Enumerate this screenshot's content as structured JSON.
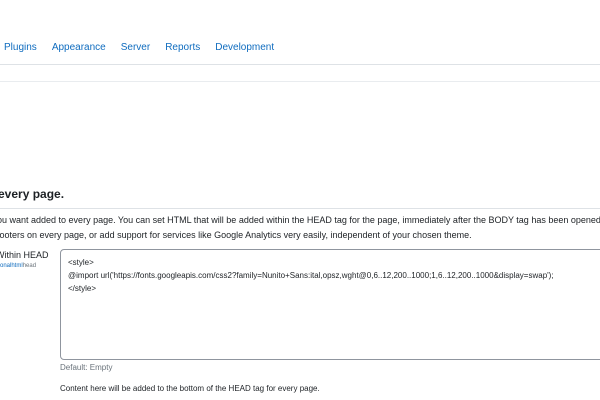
{
  "nav": {
    "items": [
      "Plugins",
      "Appearance",
      "Server",
      "Reports",
      "Development"
    ]
  },
  "section": {
    "title": "every page."
  },
  "description": {
    "line1": "ou want added to every page. You can set HTML that will be added within the HEAD tag for the page, immediately after the BODY tag has been opened, or im",
    "line2": " footers on every page, or add support for services like Google Analytics very easily, independent of your chosen theme."
  },
  "setting": {
    "label": "Within HEAD",
    "sub_link": "tionalhtml",
    "sub_tail": "head",
    "value": "<style>\n@import url('https://fonts.googleapis.com/css2?family=Nunito+Sans:ital,opsz,wght@0,6..12,200..1000;1,6..12,200..1000&display=swap');\n</style>",
    "default_text": "Default: Empty",
    "help_text": "Content here will be added to the bottom of the HEAD tag for every page."
  },
  "colors": {
    "link": "#0f6cbf",
    "muted": "#6a737b",
    "border": "#8f959e"
  }
}
